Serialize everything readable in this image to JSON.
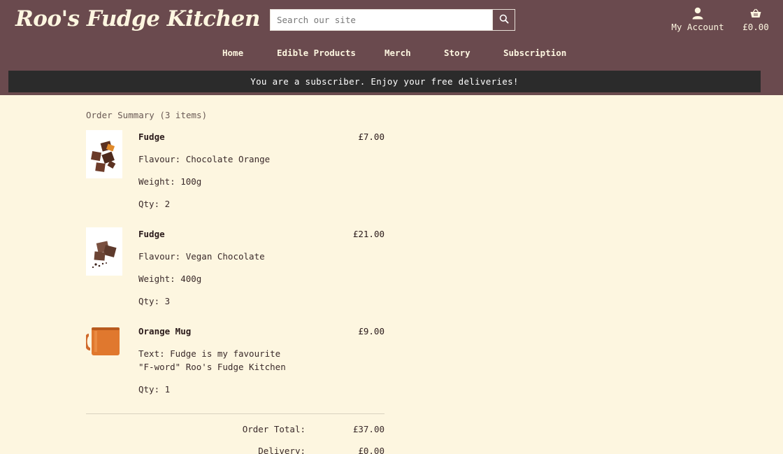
{
  "header": {
    "logo": "Roo's Fudge Kitchen",
    "search_placeholder": "Search our site",
    "account_label": "My Account",
    "cart_total": "£0.00"
  },
  "nav": {
    "items": [
      "Home",
      "Edible Products",
      "Merch",
      "Story",
      "Subscription"
    ]
  },
  "banner": "You are a subscriber. Enjoy your free deliveries!",
  "order": {
    "title": "Order Summary (3 items)",
    "items": [
      {
        "name": "Fudge",
        "price": "£7.00",
        "flavour": "Flavour: Chocolate Orange",
        "weight": "Weight: 100g",
        "qty": "Qty: 2"
      },
      {
        "name": "Fudge",
        "price": "£21.00",
        "flavour": "Flavour: Vegan Chocolate",
        "weight": "Weight: 400g",
        "qty": "Qty: 3"
      },
      {
        "name": "Orange Mug",
        "price": "£9.00",
        "text": "Text: Fudge is my favourite \"F-word\" Roo's Fudge Kitchen",
        "qty": "Qty: 1"
      }
    ],
    "totals": {
      "order_total_label": "Order Total:",
      "order_total_value": "£37.00",
      "delivery_label": "Delivery:",
      "delivery_value": "£0.00"
    }
  },
  "colors": {
    "header_bg": "#6a4a4e",
    "page_bg": "#fdf6e0",
    "banner_bg": "#2b2b2b"
  }
}
